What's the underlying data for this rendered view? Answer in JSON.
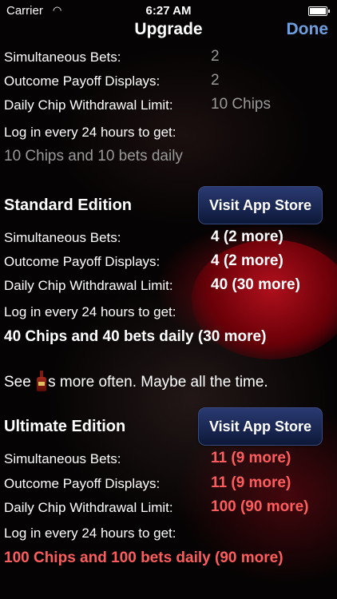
{
  "status_bar": {
    "carrier": "Carrier",
    "time": "6:27 AM"
  },
  "nav": {
    "title": "Upgrade",
    "done_label": "Done"
  },
  "current_edition": {
    "rows": [
      {
        "label": "Simultaneous Bets:",
        "value": "2"
      },
      {
        "label": "Outcome Payoff Displays:",
        "value": "2"
      },
      {
        "label": "Daily Chip Withdrawal Limit:",
        "value": "10 Chips"
      }
    ],
    "login_label": "Log in every 24 hours to get:",
    "summary": "10 Chips and 10 bets daily"
  },
  "standard_edition": {
    "title": "Standard Edition",
    "button_label": "Visit App Store",
    "rows": [
      {
        "label": "Simultaneous Bets:",
        "value": "4 (2 more)"
      },
      {
        "label": "Outcome Payoff Displays:",
        "value": "4 (2 more)"
      },
      {
        "label": "Daily Chip Withdrawal Limit:",
        "value": "40 (30 more)"
      }
    ],
    "login_label": "Log in every 24 hours to get:",
    "summary": "40 Chips and 40 bets daily (30 more)"
  },
  "promo_note": {
    "before": "See ",
    "after": "s more often. Maybe all the time."
  },
  "ultimate_edition": {
    "title": "Ultimate Edition",
    "button_label": "Visit App Store",
    "rows": [
      {
        "label": "Simultaneous Bets:",
        "value": "11 (9 more)"
      },
      {
        "label": "Outcome Payoff Displays:",
        "value": "11 (9 more)"
      },
      {
        "label": "Daily Chip Withdrawal Limit:",
        "value": "100 (90 more)"
      }
    ],
    "login_label": "Log in every 24 hours to get:",
    "summary": "100 Chips and 100 bets daily (90 more)"
  },
  "colors": {
    "done": "#6f9fe0",
    "ultimate_value": "#ff5d5d",
    "current_value": "#9a9a9a"
  }
}
